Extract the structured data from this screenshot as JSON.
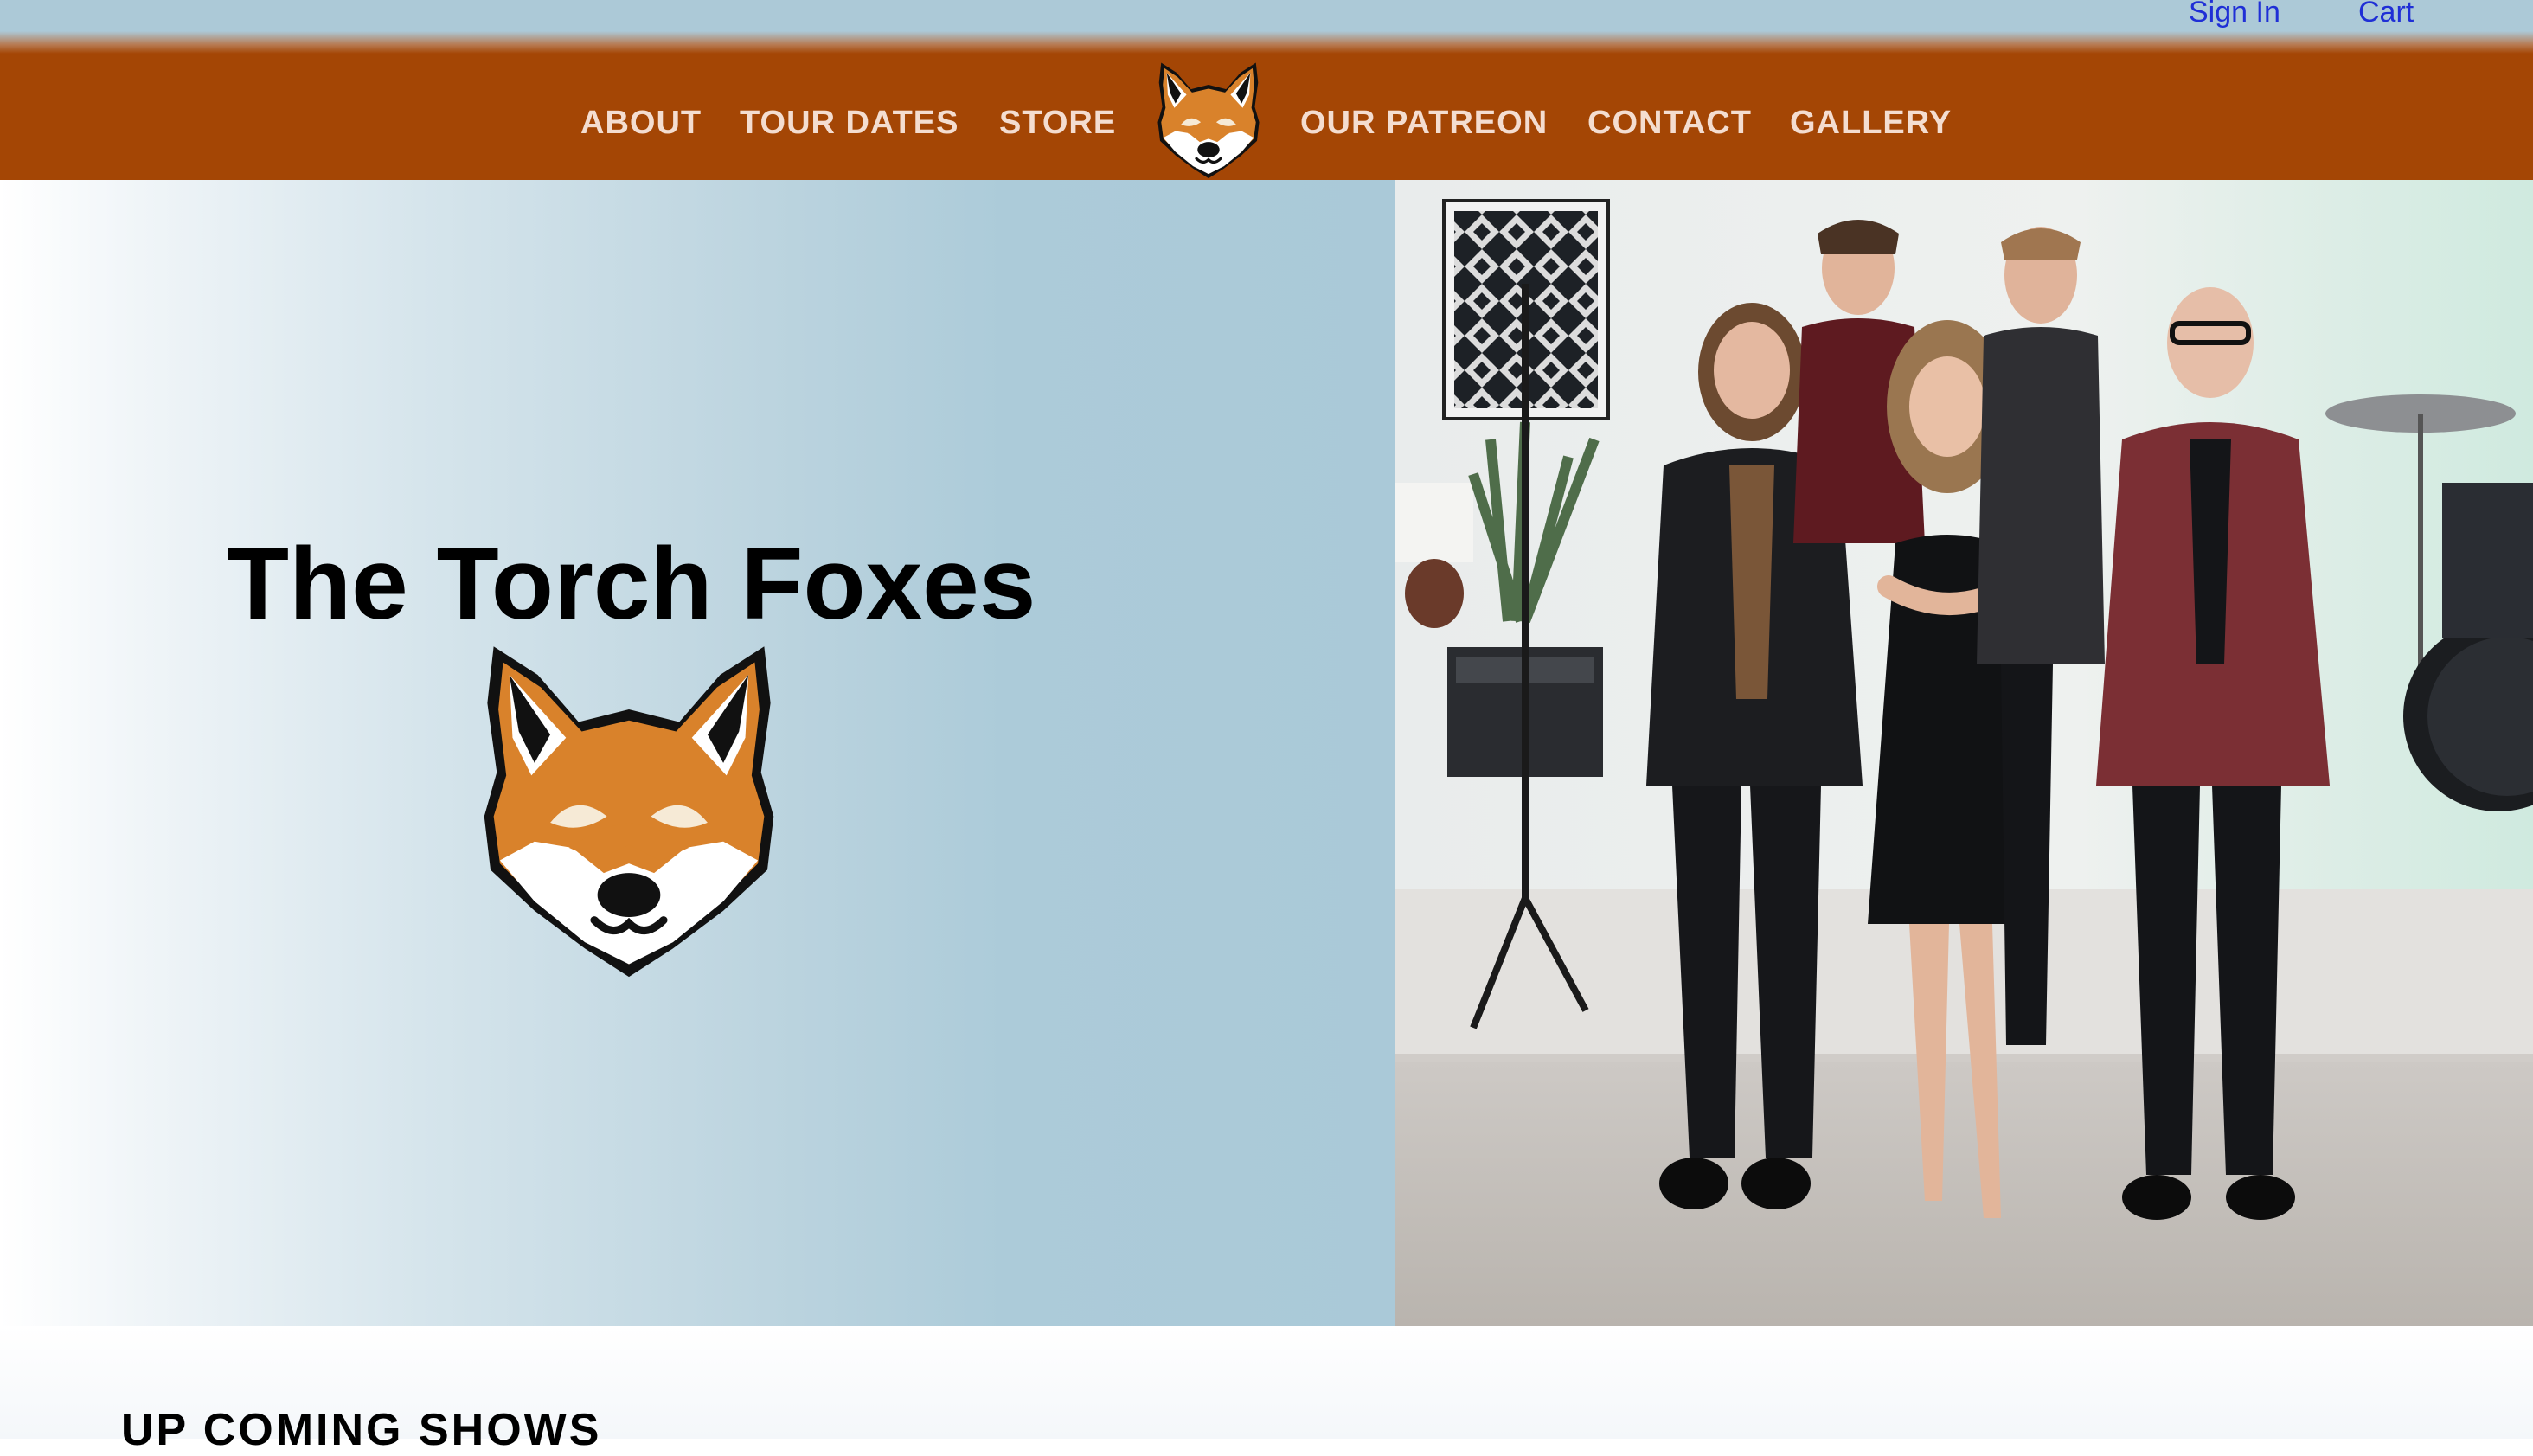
{
  "account": {
    "sign_in": "Sign In",
    "cart": "Cart"
  },
  "nav": {
    "items": [
      {
        "label": "ABOUT"
      },
      {
        "label": "TOUR DATES"
      },
      {
        "label": "STORE"
      },
      {
        "label": "OUR PATREON"
      },
      {
        "label": "CONTACT"
      },
      {
        "label": "GALLERY"
      }
    ],
    "logo_icon": "fox-head-icon"
  },
  "hero": {
    "band_name": "The Torch Foxes",
    "logo_icon": "fox-head-icon",
    "photo": "band-group-photo"
  },
  "shows": {
    "heading": "UP COMING SHOWS"
  },
  "colors": {
    "nav_background": "#a44605",
    "nav_text": "#f4ddd0",
    "link_blue": "#1f2fd6",
    "sky_blue": "#acc9d7",
    "fox_orange": "#d9822b"
  }
}
